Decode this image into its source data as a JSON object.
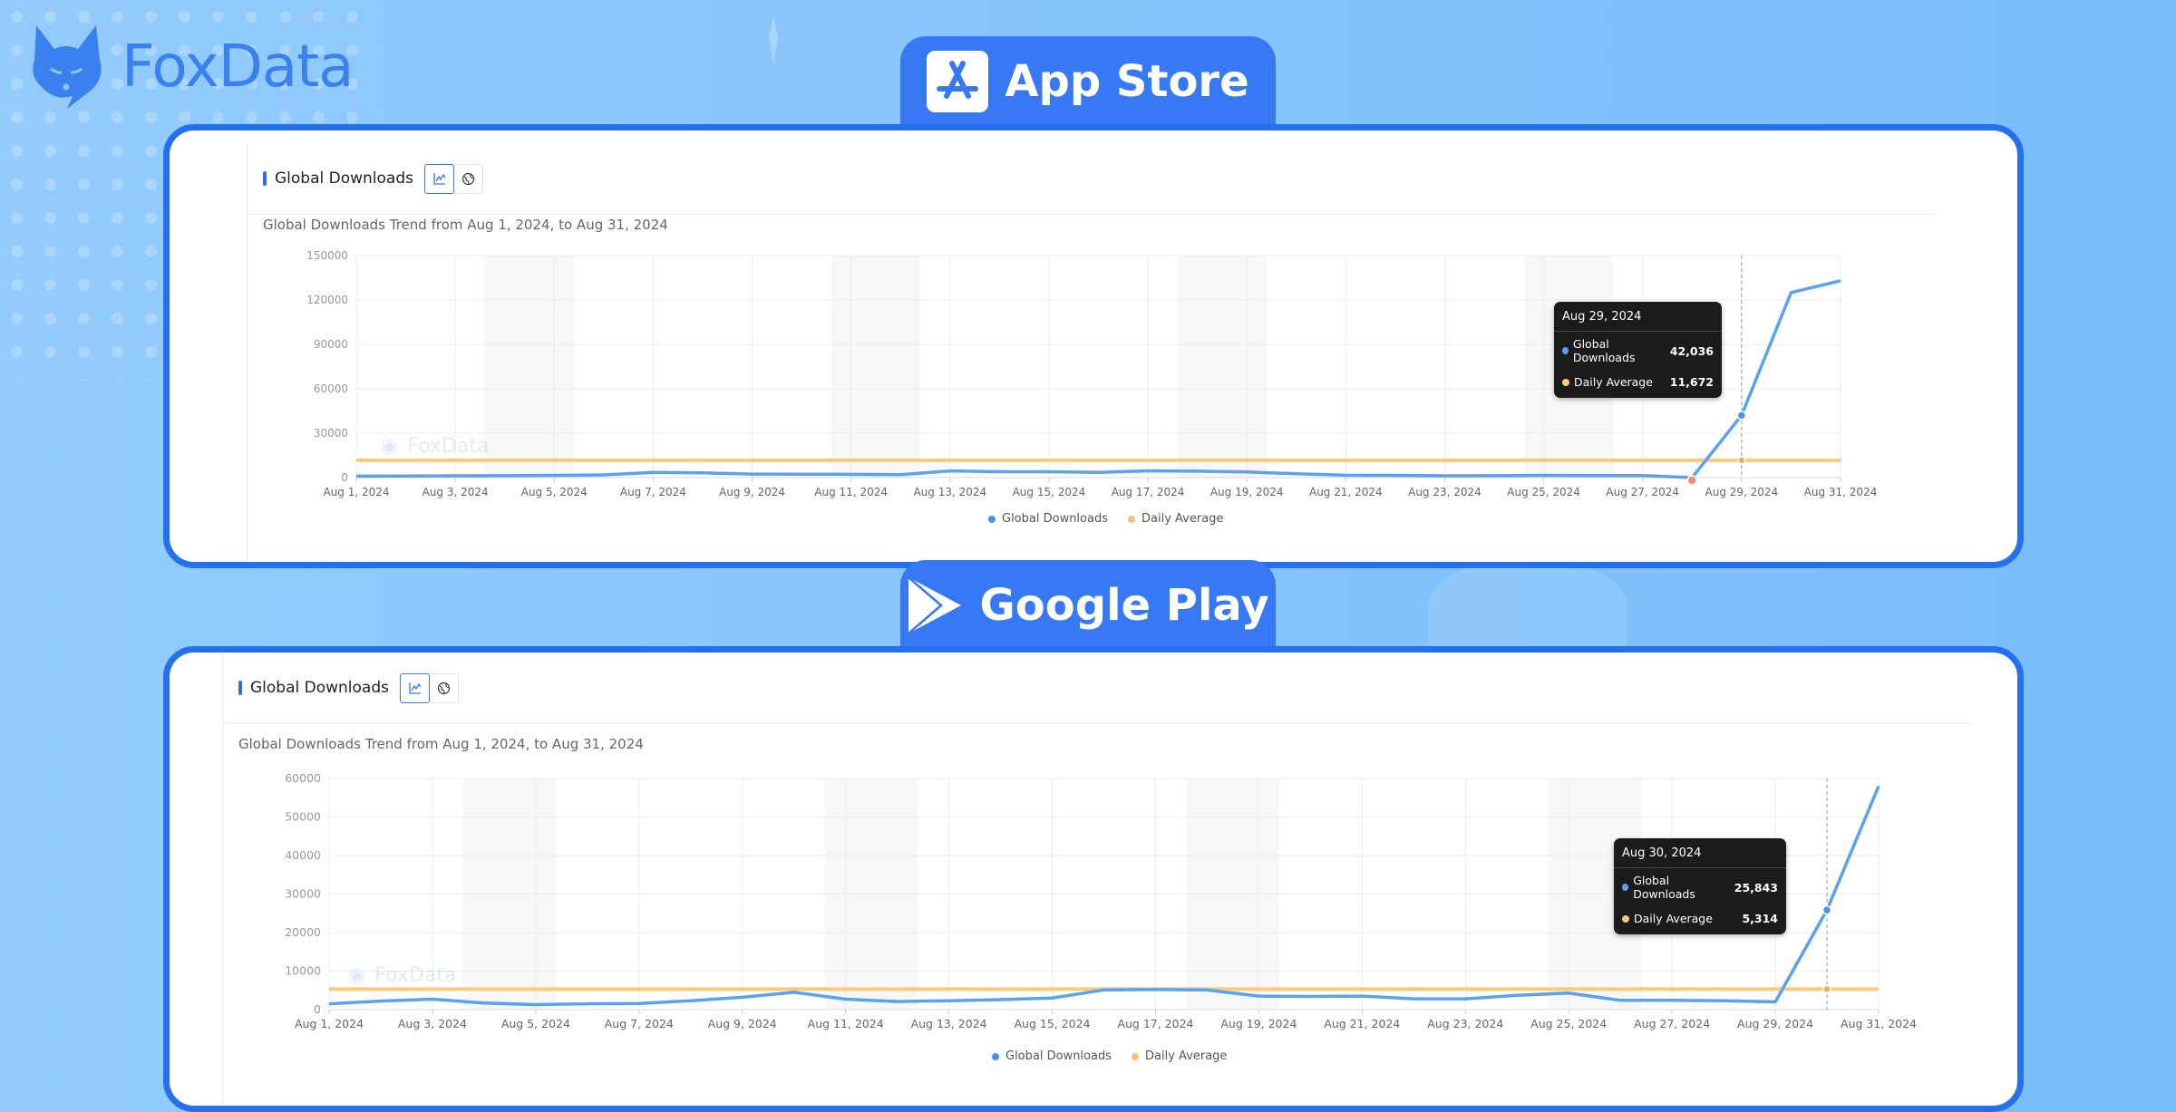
{
  "brand": {
    "name": "FoxData",
    "color": "#3a80f0"
  },
  "colors": {
    "downloads": "#5aa2f0",
    "daily_average": "#fcc979",
    "tab_bg": "#3778f4",
    "panel_border": "#2470ee",
    "tooltip_bg": "#1b1b1b",
    "min_marker": "#f09070"
  },
  "sections": [
    {
      "tab_label": "App Store",
      "tab_icon": "app-store-icon",
      "card_title": "Global Downloads",
      "toggle": [
        {
          "icon": "area-chart-icon",
          "active": true
        },
        {
          "icon": "globe-icon",
          "active": false
        }
      ],
      "subtitle": "Global Downloads Trend from Aug 1, 2024, to Aug 31, 2024",
      "watermark": "FoxData",
      "tooltip": {
        "date": "Aug 29, 2024",
        "rows": [
          {
            "label": "Global Downloads",
            "value": "42,036"
          },
          {
            "label": "Daily Average",
            "value": "11,672"
          }
        ]
      },
      "legend": [
        "Global Downloads",
        "Daily Average"
      ]
    },
    {
      "tab_label": "Google Play",
      "tab_icon": "google-play-icon",
      "card_title": "Global Downloads",
      "toggle": [
        {
          "icon": "area-chart-icon",
          "active": true
        },
        {
          "icon": "globe-icon",
          "active": false
        }
      ],
      "subtitle": "Global Downloads Trend from Aug 1, 2024, to Aug 31, 2024",
      "watermark": "FoxData",
      "tooltip": {
        "date": "Aug 30, 2024",
        "rows": [
          {
            "label": "Global Downloads",
            "value": "25,843"
          },
          {
            "label": "Daily Average",
            "value": "5,314"
          }
        ]
      },
      "legend": [
        "Global Downloads",
        "Daily Average"
      ]
    }
  ],
  "chart_data": [
    {
      "type": "line",
      "title": "Global Downloads Trend from Aug 1, 2024, to Aug 31, 2024",
      "xlabel": "",
      "ylabel": "",
      "x": [
        "Aug 1, 2024",
        "Aug 2, 2024",
        "Aug 3, 2024",
        "Aug 4, 2024",
        "Aug 5, 2024",
        "Aug 6, 2024",
        "Aug 7, 2024",
        "Aug 8, 2024",
        "Aug 9, 2024",
        "Aug 10, 2024",
        "Aug 11, 2024",
        "Aug 12, 2024",
        "Aug 13, 2024",
        "Aug 14, 2024",
        "Aug 15, 2024",
        "Aug 16, 2024",
        "Aug 17, 2024",
        "Aug 18, 2024",
        "Aug 19, 2024",
        "Aug 20, 2024",
        "Aug 21, 2024",
        "Aug 22, 2024",
        "Aug 23, 2024",
        "Aug 24, 2024",
        "Aug 25, 2024",
        "Aug 26, 2024",
        "Aug 27, 2024",
        "Aug 28, 2024",
        "Aug 29, 2024",
        "Aug 30, 2024",
        "Aug 31, 2024"
      ],
      "x_tick_labels": [
        "Aug 1, 2024",
        "Aug 3, 2024",
        "Aug 5, 2024",
        "Aug 7, 2024",
        "Aug 9, 2024",
        "Aug 11, 2024",
        "Aug 13, 2024",
        "Aug 15, 2024",
        "Aug 17, 2024",
        "Aug 19, 2024",
        "Aug 21, 2024",
        "Aug 23, 2024",
        "Aug 25, 2024",
        "Aug 27, 2024",
        "Aug 29, 2024",
        "Aug 31, 2024"
      ],
      "y_ticks": [
        0,
        30000,
        60000,
        90000,
        120000,
        150000
      ],
      "ylim": [
        0,
        150000
      ],
      "grid": true,
      "legend_position": "bottom-center",
      "shaded_weekends": [
        [
          3,
          4
        ],
        [
          10,
          11
        ],
        [
          17,
          18
        ],
        [
          24,
          25
        ]
      ],
      "series": [
        {
          "name": "Global Downloads",
          "values": [
            1000,
            1100,
            1200,
            1300,
            1500,
            1800,
            3500,
            3200,
            2400,
            2300,
            2200,
            2000,
            4500,
            4000,
            4000,
            3500,
            4500,
            4400,
            3800,
            2600,
            1600,
            1500,
            1200,
            1300,
            1500,
            1400,
            1400,
            0,
            42036,
            125000,
            133000
          ]
        },
        {
          "name": "Daily Average",
          "values": [
            11672,
            11672,
            11672,
            11672,
            11672,
            11672,
            11672,
            11672,
            11672,
            11672,
            11672,
            11672,
            11672,
            11672,
            11672,
            11672,
            11672,
            11672,
            11672,
            11672,
            11672,
            11672,
            11672,
            11672,
            11672,
            11672,
            11672,
            11672,
            11672,
            11672,
            11672
          ]
        }
      ],
      "highlight_index": 28,
      "min_marker_index": 27
    },
    {
      "type": "line",
      "title": "Global Downloads Trend from Aug 1, 2024, to Aug 31, 2024",
      "xlabel": "",
      "ylabel": "",
      "x": [
        "Aug 1, 2024",
        "Aug 2, 2024",
        "Aug 3, 2024",
        "Aug 4, 2024",
        "Aug 5, 2024",
        "Aug 6, 2024",
        "Aug 7, 2024",
        "Aug 8, 2024",
        "Aug 9, 2024",
        "Aug 10, 2024",
        "Aug 11, 2024",
        "Aug 12, 2024",
        "Aug 13, 2024",
        "Aug 14, 2024",
        "Aug 15, 2024",
        "Aug 16, 2024",
        "Aug 17, 2024",
        "Aug 18, 2024",
        "Aug 19, 2024",
        "Aug 20, 2024",
        "Aug 21, 2024",
        "Aug 22, 2024",
        "Aug 23, 2024",
        "Aug 24, 2024",
        "Aug 25, 2024",
        "Aug 26, 2024",
        "Aug 27, 2024",
        "Aug 28, 2024",
        "Aug 29, 2024",
        "Aug 30, 2024",
        "Aug 31, 2024"
      ],
      "x_tick_labels": [
        "Aug 1, 2024",
        "Aug 3, 2024",
        "Aug 5, 2024",
        "Aug 7, 2024",
        "Aug 9, 2024",
        "Aug 11, 2024",
        "Aug 13, 2024",
        "Aug 15, 2024",
        "Aug 17, 2024",
        "Aug 19, 2024",
        "Aug 21, 2024",
        "Aug 23, 2024",
        "Aug 25, 2024",
        "Aug 27, 2024",
        "Aug 29, 2024",
        "Aug 31, 2024"
      ],
      "y_ticks": [
        0,
        10000,
        20000,
        30000,
        40000,
        50000,
        60000
      ],
      "ylim": [
        0,
        60000
      ],
      "grid": true,
      "legend_position": "bottom-center",
      "shaded_weekends": [
        [
          3,
          4
        ],
        [
          10,
          11
        ],
        [
          17,
          18
        ],
        [
          24,
          25
        ]
      ],
      "series": [
        {
          "name": "Global Downloads",
          "values": [
            1500,
            2200,
            2700,
            1700,
            1300,
            1500,
            1600,
            2300,
            3200,
            4500,
            2700,
            2100,
            2300,
            2600,
            3000,
            5100,
            5200,
            5100,
            3500,
            3400,
            3500,
            2800,
            2800,
            3700,
            4300,
            2400,
            2400,
            2300,
            2000,
            25843,
            58000
          ]
        },
        {
          "name": "Daily Average",
          "values": [
            5314,
            5314,
            5314,
            5314,
            5314,
            5314,
            5314,
            5314,
            5314,
            5314,
            5314,
            5314,
            5314,
            5314,
            5314,
            5314,
            5314,
            5314,
            5314,
            5314,
            5314,
            5314,
            5314,
            5314,
            5314,
            5314,
            5314,
            5314,
            5314,
            5314,
            5314
          ]
        }
      ],
      "highlight_index": 29
    }
  ]
}
